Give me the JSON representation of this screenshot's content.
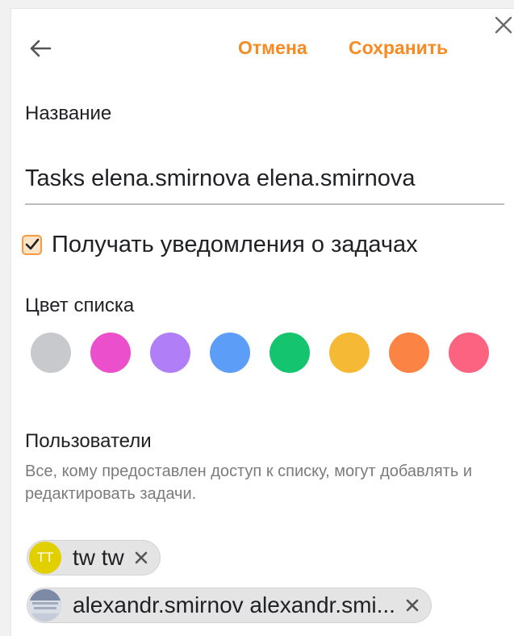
{
  "header": {
    "cancel_label": "Отмена",
    "save_label": "Сохранить"
  },
  "form": {
    "name_label": "Название",
    "name_value": "Tasks elena.smirnova elena.smirnova",
    "notify_label": "Получать уведомления о задачах",
    "notify_checked": true,
    "color_label": "Цвет списка",
    "colors": [
      "#c7c9cc",
      "#ec4fcb",
      "#b07ef7",
      "#5c9df8",
      "#14c46f",
      "#f5b936",
      "#fb8444",
      "#fb6380"
    ]
  },
  "users": {
    "title": "Пользователи",
    "hint": "Все, кому предоставлен доступ к списку, могут добавлять и редактировать задачи.",
    "members": [
      {
        "initials": "TT",
        "name": "tw tw",
        "avatar_color": "#e1cf00"
      },
      {
        "initials": "",
        "name": "alexandr.smirnov alexandr.smi...",
        "avatar_color": "#8e9bb5"
      }
    ]
  },
  "icons": {
    "back": "arrow-left-icon",
    "close": "close-icon",
    "check": "checkmark-icon",
    "chip_remove": "close-icon"
  },
  "accent_color": "#f58b22"
}
